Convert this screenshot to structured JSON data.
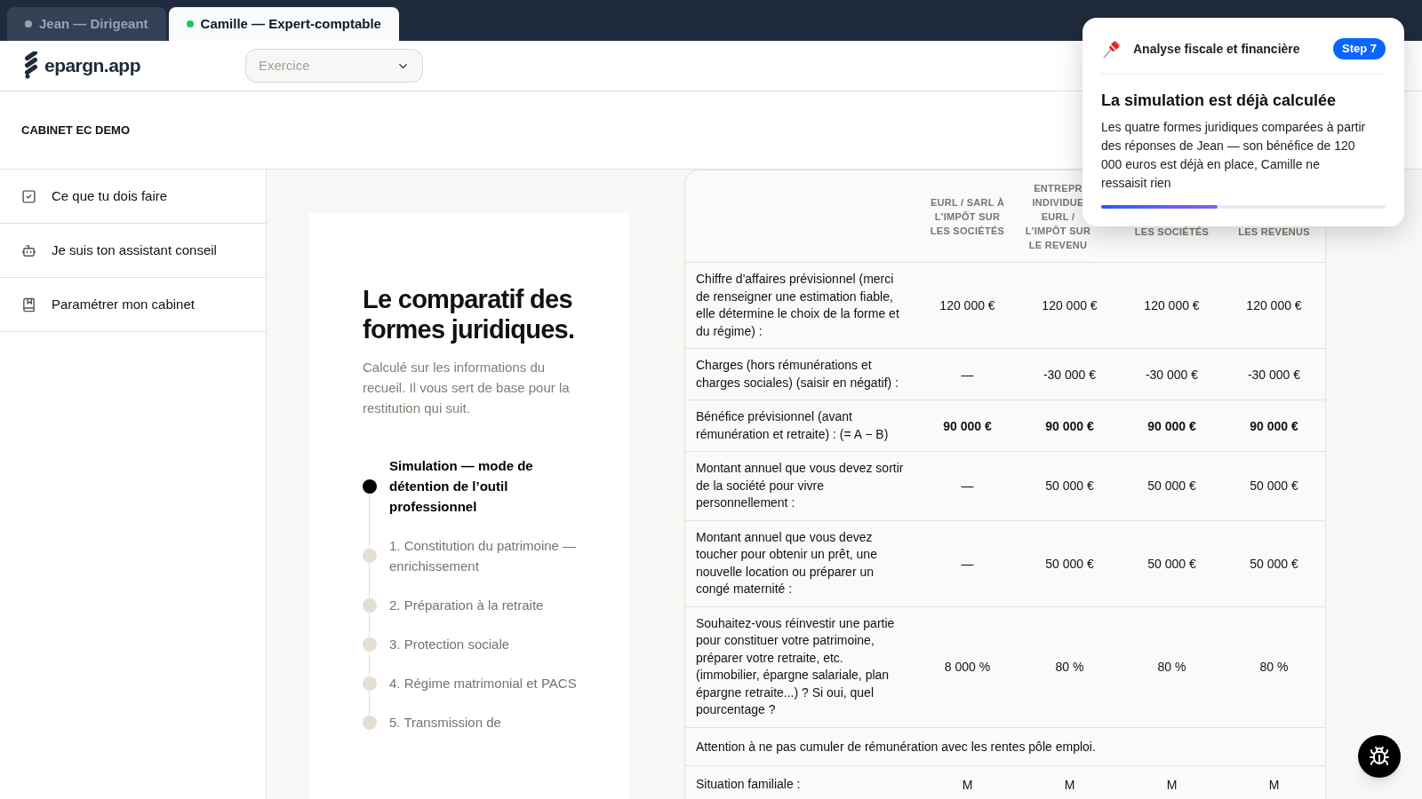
{
  "tabs": [
    {
      "label": "Jean — Dirigeant",
      "selected": false,
      "color": "#9ca3af"
    },
    {
      "label": "Camille — Expert-comptable",
      "selected": true,
      "color": "#22c55e"
    }
  ],
  "header": {
    "logo": "epargn.app",
    "select": {
      "placeholder": "Exercice"
    }
  },
  "cabinet": "CABINET EC DEMO",
  "sidebar": {
    "items": [
      {
        "label": "Ce que tu dois faire"
      },
      {
        "label": "Je suis ton assistant conseil"
      },
      {
        "label": "Paramétrer mon cabinet"
      }
    ]
  },
  "intro": {
    "title": "Le comparatif des formes juridiques.",
    "subtitle": "Calculé sur les informations du recueil. Il vous sert de base pour la restitution qui suit.",
    "steps": [
      {
        "label": "Simulation — mode de détention de l’outil professionnel",
        "selected": true
      },
      {
        "label": "1. Constitution du patrimoine — enrichissement",
        "selected": false
      },
      {
        "label": "2. Préparation à la retraite",
        "selected": false
      },
      {
        "label": "3. Protection sociale",
        "selected": false
      },
      {
        "label": "4. Régime matrimonial et PACS",
        "selected": false
      },
      {
        "label": "5. Transmission de",
        "selected": false
      }
    ]
  },
  "table": {
    "columns": [
      {
        "lines": [
          "EURL / SARL À",
          "L'IMPÔT SUR",
          "LES SOCIÉTÉS"
        ]
      },
      {
        "lines": [
          "ENTREPR",
          "INDIVIDUE",
          "EURL /",
          "L'IMPÔT SUR",
          "LE REVENU"
        ]
      },
      {
        "lines": [
          "LES SOCIÉTÉS"
        ]
      },
      {
        "lines": [
          "LES REVENUS"
        ]
      }
    ],
    "rows": [
      {
        "kind": "value",
        "label": "Chiffre d'affaires prévisionnel (merci de renseigner une estimation fiable, elle détermine le choix de la forme et du régime) :",
        "cells": [
          "120 000 €",
          "120 000 €",
          "120 000 €",
          "120 000 €"
        ]
      },
      {
        "kind": "value",
        "label": "Charges (hors rémunérations et charges sociales) (saisir en négatif) :",
        "cells": [
          "—",
          "-30 000 €",
          "-30 000 €",
          "-30 000 €"
        ]
      },
      {
        "kind": "total",
        "label": "Bénéfice prévisionnel (avant rémunération et retraite) : (= A − B)",
        "cells": [
          "90 000 €",
          "90 000 €",
          "90 000 €",
          "90 000 €"
        ]
      },
      {
        "kind": "value",
        "label": "Montant annuel que vous devez sortir de la société pour vivre personnellement :",
        "cells": [
          "—",
          "50 000 €",
          "50 000 €",
          "50 000 €"
        ]
      },
      {
        "kind": "value",
        "label": "Montant annuel que vous devez toucher pour obtenir un prêt, une nouvelle location ou préparer un congé maternité :",
        "cells": [
          "—",
          "50 000 €",
          "50 000 €",
          "50 000 €"
        ]
      },
      {
        "kind": "value",
        "label": "Souhaitez-vous réinvestir une partie pour constituer votre patrimoine, préparer votre retraite, etc. (immobilier, épargne salariale, plan épargne retraite...) ? Si oui, quel pourcentage ?",
        "cells": [
          "8 000 %",
          "80 %",
          "80 %",
          "80 %"
        ]
      },
      {
        "kind": "note",
        "label": "Attention à ne pas cumuler de rémunération avec les rentes pôle emploi."
      },
      {
        "kind": "value",
        "label": "Situation familiale :",
        "cells": [
          "M",
          "M",
          "M",
          "M"
        ]
      }
    ]
  },
  "tour": {
    "section": "Analyse fiscale et financière",
    "step": "Step 7",
    "title": "La simulation est déjà calculée",
    "body": "Les quatre formes juridiques comparées à partir des réponses de Jean — son bénéfice de 120 000 euros est déjà en place, Camille ne ressaisit rien",
    "level": 0.41
  }
}
